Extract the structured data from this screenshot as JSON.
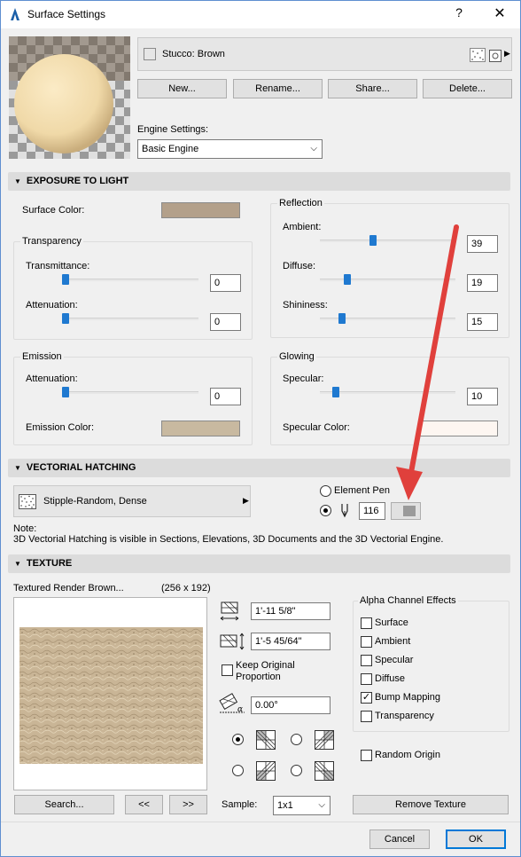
{
  "window": {
    "title": "Surface Settings",
    "help": "?",
    "close": "✕"
  },
  "surface": {
    "name": "Stucco: Brown",
    "swatch_color": "#b3a08a"
  },
  "buttons": {
    "new": "New...",
    "rename": "Rename...",
    "share": "Share...",
    "delete": "Delete..."
  },
  "engine": {
    "label": "Engine Settings:",
    "value": "Basic Engine"
  },
  "exposure": {
    "header": "EXPOSURE TO LIGHT",
    "surface_color_label": "Surface Color:",
    "surface_color": "#b3a08a",
    "transparency": {
      "title": "Transparency",
      "transmittance_label": "Transmittance:",
      "transmittance": "0",
      "attenuation_label": "Attenuation:",
      "attenuation": "0"
    },
    "reflection": {
      "title": "Reflection",
      "ambient_label": "Ambient:",
      "ambient": "39",
      "diffuse_label": "Diffuse:",
      "diffuse": "19",
      "shininess_label": "Shininess:",
      "shininess": "15"
    },
    "emission": {
      "title": "Emission",
      "attenuation_label": "Attenuation:",
      "attenuation": "0",
      "color_label": "Emission Color:",
      "color": "#c8b9a0"
    },
    "glowing": {
      "title": "Glowing",
      "specular_label": "Specular:",
      "specular": "10",
      "specular_color_label": "Specular Color:",
      "specular_color": "#fdf6f1"
    }
  },
  "hatching": {
    "header": "VECTORIAL HATCHING",
    "pattern": "Stipple-Random, Dense",
    "element_pen_label": "Element Pen",
    "pen_number": "116",
    "note_title": "Note:",
    "note_text": "3D Vectorial Hatching is visible in Sections, Elevations, 3D Documents and the 3D Vectorial Engine."
  },
  "texture": {
    "header": "TEXTURE",
    "name": "Textured Render Brown...",
    "size": "(256 x 192)",
    "width": "1'-11 5/8\"",
    "height": "1'-5 45/64\"",
    "keep_proportion": "Keep Original Proportion",
    "angle": "0.00°",
    "search": "Search...",
    "prev": "<<",
    "next": ">>",
    "sample_label": "Sample:",
    "sample_value": "1x1",
    "remove": "Remove Texture",
    "alpha": {
      "title": "Alpha Channel Effects",
      "surface": "Surface",
      "ambient": "Ambient",
      "specular": "Specular",
      "diffuse": "Diffuse",
      "bump": "Bump Mapping",
      "transparency": "Transparency",
      "bump_checked": "✓"
    },
    "random_origin": "Random Origin"
  },
  "footer": {
    "cancel": "Cancel",
    "ok": "OK"
  },
  "colors": {
    "accent": "#1f79d0",
    "annotation_arrow": "#e0403c"
  }
}
